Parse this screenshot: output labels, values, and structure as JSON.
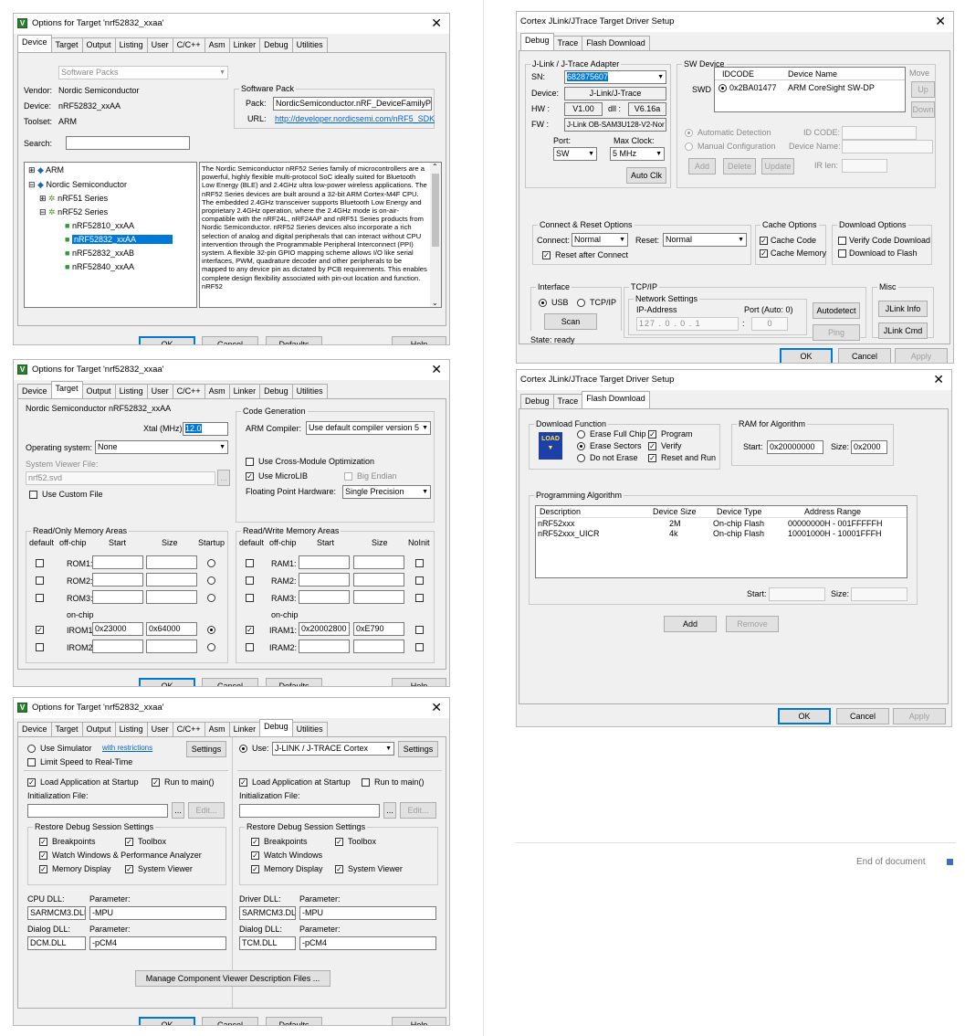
{
  "dlg1": {
    "title": "Options for Target 'nrf52832_xxaa'",
    "tabs": [
      "Device",
      "Target",
      "Output",
      "Listing",
      "User",
      "C/C++",
      "Asm",
      "Linker",
      "Debug",
      "Utilities"
    ],
    "software_packs": "Software Packs",
    "vendor_label": "Vendor:",
    "vendor": "Nordic Semiconductor",
    "device_label": "Device:",
    "device": "nRF52832_xxAA",
    "toolset_label": "Toolset:",
    "toolset": "ARM",
    "search_label": "Search:",
    "pack_group": "Software Pack",
    "pack_label": "Pack:",
    "pack": "NordicSemiconductor.nRF_DeviceFamilyPac",
    "url_label": "URL:",
    "url": "http://developer.nordicsemi.com/nRF5_SDK",
    "tree": [
      "ARM",
      "Nordic Semiconductor",
      "nRF51 Series",
      "nRF52 Series",
      "nRF52810_xxAA",
      "nRF52832_xxAA",
      "nRF52832_xxAB",
      "nRF52840_xxAA"
    ],
    "description": "The Nordic Semiconductor nRF52 Series family of microcontrollers are a powerful, highly flexible multi-protocol SoC ideally suited for Bluetooth Low Energy (BLE) and 2.4GHz ultra low-power wireless applications. The nRF52 Series devices are built around a 32-bit ARM Cortex-M4F CPU. The embedded 2.4GHz transceiver supports Bluetooth Low Energy and proprietary 2.4GHz operation, where the 2.4GHz mode is on-air-compatible with the nRF24L, nRF24AP and nRF51 Series products from Nordic Semiconductor. nRF52 Series devices also incorporate a rich selection of analog and digital peripherals that can interact without CPU intervention through the Programmable Peripheral Interconnect (PPI) system. A flexible 32-pin GPIO mapping scheme allows I/O like serial interfaces, PWM, quadrature decoder and other peripherals to be mapped to any device pin as dictated by PCB requirements. This enables complete design flexibility associated with pin-out location and function. nRF52",
    "ok": "OK",
    "cancel": "Cancel",
    "defaults": "Defaults",
    "help": "Help"
  },
  "dlg2": {
    "title": "Options for Target 'nrf52832_xxaa'",
    "tabs": [
      "Device",
      "Target",
      "Output",
      "Listing",
      "User",
      "C/C++",
      "Asm",
      "Linker",
      "Debug",
      "Utilities"
    ],
    "device_name": "Nordic Semiconductor nRF52832_xxAA",
    "xtal_label": "Xtal (MHz):",
    "xtal": "12.0",
    "os_label": "Operating system:",
    "os": "None",
    "svf_label": "System Viewer File:",
    "svf": "nrf52.svd",
    "use_custom_file": "Use Custom File",
    "code_gen": "Code Generation",
    "arm_compiler_label": "ARM Compiler:",
    "arm_compiler": "Use default compiler version 5",
    "cross_module": "Use Cross-Module Optimization",
    "microlib": "Use MicroLIB",
    "big_endian": "Big Endian",
    "fp_label": "Floating Point Hardware:",
    "fp": "Single Precision",
    "ro_group": "Read/Only Memory Areas",
    "rw_group": "Read/Write Memory Areas",
    "col_default": "default",
    "col_offchip": "off-chip",
    "col_start": "Start",
    "col_size": "Size",
    "col_startup": "Startup",
    "col_noinit": "NoInit",
    "onchip": "on-chip",
    "rom": [
      "ROM1:",
      "ROM2:",
      "ROM3:"
    ],
    "irom": [
      "IROM1:",
      "IROM2:"
    ],
    "irom1_start": "0x23000",
    "irom1_size": "0x64000",
    "ram": [
      "RAM1:",
      "RAM2:",
      "RAM3:"
    ],
    "iram": [
      "IRAM1:",
      "IRAM2:"
    ],
    "iram1_start": "0x20002800",
    "iram1_size": "0xE790",
    "ok": "OK",
    "cancel": "Cancel",
    "defaults": "Defaults",
    "help": "Help"
  },
  "dlg3": {
    "title": "Options for Target 'nrf52832_xxaa'",
    "tabs": [
      "Device",
      "Target",
      "Output",
      "Listing",
      "User",
      "C/C++",
      "Asm",
      "Linker",
      "Debug",
      "Utilities"
    ],
    "use_simulator": "Use Simulator",
    "with_restrictions": "with restrictions",
    "settings": "Settings",
    "limit_speed": "Limit Speed to Real-Time",
    "use": "Use:",
    "use_value": "J-LINK / J-TRACE Cortex",
    "load_app": "Load Application at Startup",
    "run_main": "Run to main()",
    "init_file": "Initialization File:",
    "dots": "...",
    "edit": "Edit...",
    "restore": "Restore Debug Session Settings",
    "breakpoints": "Breakpoints",
    "toolbox": "Toolbox",
    "watch_perf": "Watch Windows & Performance Analyzer",
    "watch": "Watch Windows",
    "memory_display": "Memory Display",
    "system_viewer": "System Viewer",
    "cpu_dll": "CPU DLL:",
    "driver_dll": "Driver DLL:",
    "parameter": "Parameter:",
    "sarmcm3": "SARMCM3.DLL",
    "mpu": "-MPU",
    "dialog_dll": "Dialog DLL:",
    "dcm": "DCM.DLL",
    "tcm": "TCM.DLL",
    "pcm4": "-pCM4",
    "manage": "Manage Component Viewer Description Files ...",
    "ok": "OK",
    "cancel": "Cancel",
    "defaults": "Defaults",
    "help": "Help"
  },
  "dlg4": {
    "title": "Cortex JLink/JTrace Target Driver Setup",
    "tabs": [
      "Debug",
      "Trace",
      "Flash Download"
    ],
    "adapter_group": "J-Link / J-Trace Adapter",
    "sn_label": "SN:",
    "sn": "682875607",
    "device_label": "Device:",
    "device": "J-Link/J-Trace",
    "hw_label": "HW :",
    "hw": "V1.00",
    "dll_label": "dll :",
    "dll": "V6.16a",
    "fw_label": "FW :",
    "fw": "J-Link OB-SAM3U128-V2-Nor",
    "port_label": "Port:",
    "port": "SW",
    "maxclk_label": "Max Clock:",
    "maxclk": "5 MHz",
    "auto_clk": "Auto Clk",
    "sw_group": "SW Device",
    "swd": "SWD",
    "col_idcode": "IDCODE",
    "col_devname": "Device Name",
    "idcode": "0x2BA01477",
    "devname": "ARM CoreSight SW-DP",
    "move": "Move",
    "up": "Up",
    "down": "Down",
    "auto_detect": "Automatic Detection",
    "manual_conf": "Manual Configuration",
    "id_code_label": "ID CODE:",
    "device_name_label": "Device Name:",
    "ir_len_label": "IR len:",
    "add": "Add",
    "delete": "Delete",
    "update": "Update",
    "connect_group": "Connect & Reset Options",
    "connect_label": "Connect:",
    "connect": "Normal",
    "reset_label": "Reset:",
    "reset": "Normal",
    "reset_after": "Reset after Connect",
    "cache_group": "Cache Options",
    "cache_code": "Cache Code",
    "cache_memory": "Cache Memory",
    "dl_group": "Download Options",
    "verify_dl": "Verify Code Download",
    "dl_flash": "Download to Flash",
    "iface_group": "Interface",
    "usb": "USB",
    "tcpip": "TCP/IP",
    "scan": "Scan",
    "state": "State: ready",
    "tcp_group": "TCP/IP",
    "net_group": "Network Settings",
    "ip_label": "IP-Address",
    "port_auto_label": "Port (Auto: 0)",
    "ip": [
      "127",
      "0",
      "0",
      "1"
    ],
    "port_val": "0",
    "autodetect": "Autodetect",
    "ping": "Ping",
    "misc_group": "Misc",
    "jlink_info": "JLink Info",
    "jlink_cmd": "JLink Cmd",
    "ok": "OK",
    "cancel": "Cancel",
    "apply": "Apply"
  },
  "dlg5": {
    "title": "Cortex JLink/JTrace Target Driver Setup",
    "tabs": [
      "Debug",
      "Trace",
      "Flash Download"
    ],
    "dl_func": "Download Function",
    "load": "LOAD",
    "erase_full": "Erase Full Chip",
    "erase_sectors": "Erase Sectors",
    "no_erase": "Do not Erase",
    "program": "Program",
    "verify": "Verify",
    "reset_run": "Reset and Run",
    "ram_group": "RAM for Algorithm",
    "start_label": "Start:",
    "ram_start": "0x20000000",
    "size_label": "Size:",
    "ram_size": "0x2000",
    "prog_group": "Programming Algorithm",
    "cols": [
      "Description",
      "Device Size",
      "Device Type",
      "Address Range"
    ],
    "rows": [
      [
        "nRF52xxx",
        "2M",
        "On-chip Flash",
        "00000000H - 001FFFFFH"
      ],
      [
        "nRF52xxx_UICR",
        "4k",
        "On-chip Flash",
        "10001000H - 10001FFFH"
      ]
    ],
    "add": "Add",
    "remove": "Remove",
    "ok": "OK",
    "cancel": "Cancel",
    "apply": "Apply"
  },
  "footer": "End of document"
}
